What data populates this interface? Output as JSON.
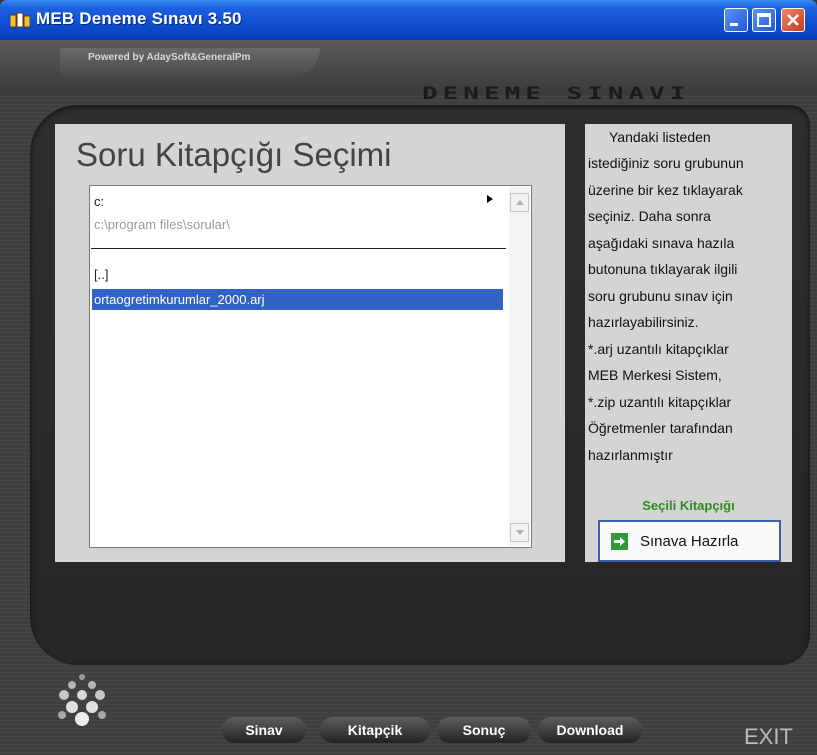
{
  "window": {
    "title": "MEB Deneme Sınavı 3.50",
    "powered_by": "Powered by AdaySoft&GeneralPm",
    "brand_text": "DENEME SINAVI",
    "icons": {
      "app": "app-icon",
      "minimize": "minimize-icon",
      "maximize": "maximize-icon",
      "close": "close-icon"
    }
  },
  "main": {
    "title": "Soru Kitapçığı Seçimi",
    "drive": "c:",
    "path": "c:\\program files\\sorular\\",
    "files": [
      "[..]",
      "ortaogretimkurumlar_2000.arj"
    ],
    "selected_index": 1
  },
  "info": {
    "lines": [
      "Yandaki listeden",
      "istediğiniz soru grubunun",
      "üzerine  bir kez tıklayarak",
      "seçiniz.  Daha  sonra",
      "aşağıdaki  sınava  hazıla",
      "butonuna  tıklayarak ilgili",
      "soru grubunu sınav  için",
      "hazırlayabilirsiniz.",
      "*.arj uzantılı kitapçıklar",
      "MEB Merkesi Sistem,",
      "*.zip uzantılı kitapçıklar",
      "Öğretmenler tarafından",
      "hazırlanmıştır"
    ],
    "selected_label": "Seçili Kitapçığı",
    "prepare_button": "Sınava Hazırla"
  },
  "nav": {
    "items": [
      "Sinav",
      "Kitapçik",
      "Sonuç",
      "Download"
    ],
    "exit": "EXIT"
  },
  "colors": {
    "titlebar": "#0f4fd2",
    "selection": "#3163c5",
    "panel": "#d4d4d4",
    "accent_green": "#2e8b1e"
  }
}
